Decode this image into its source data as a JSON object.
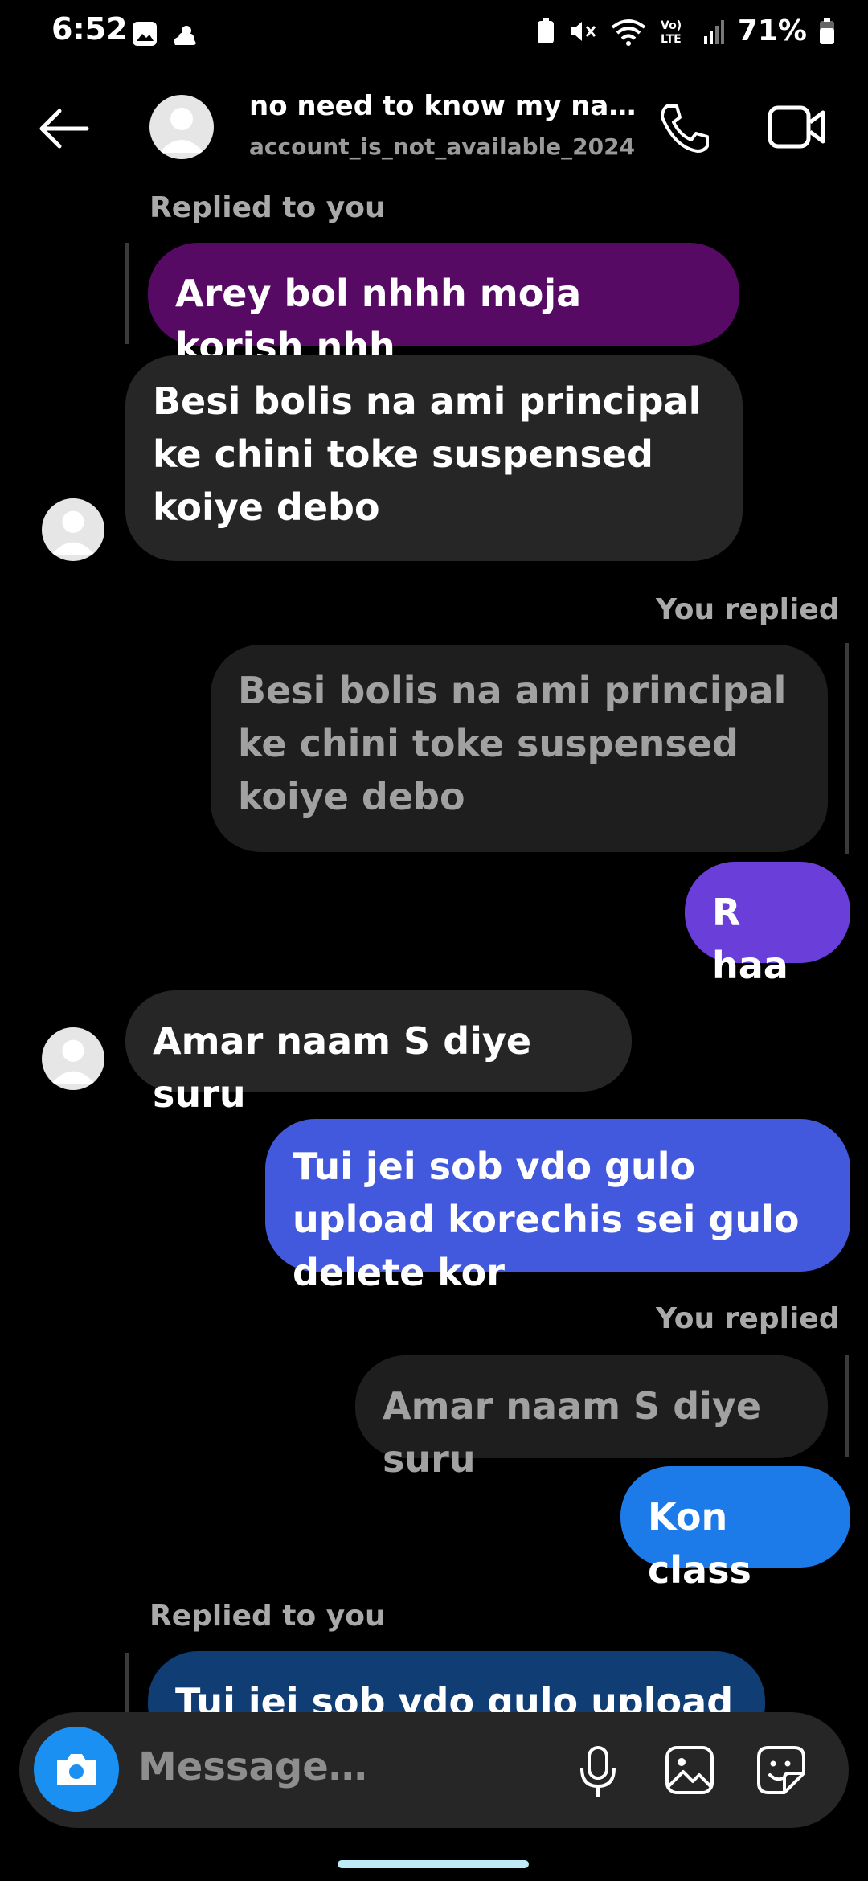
{
  "status_bar": {
    "time": "6:52",
    "battery": "71%"
  },
  "header": {
    "name": "no need to know my na…",
    "username": "account_is_not_available_2024"
  },
  "messages": [
    {
      "label": "Replied to you",
      "quoted": "Arey bol nhhh moja korish nhh",
      "text": "Besi bolis na ami principal ke chini toke suspensed koiye debo"
    },
    {
      "label": "You replied",
      "quoted": "Besi bolis na ami principal ke chini toke suspensed koiye debo",
      "text": "R haa"
    },
    {
      "text": "Amar naam S diye suru"
    },
    {
      "text": "Tui jei sob vdo gulo upload korechis sei gulo delete kor"
    },
    {
      "label": "You replied",
      "quoted": "Amar naam S diye suru",
      "text": "Kon class"
    },
    {
      "label": "Replied to you",
      "quoted": "Tui jei sob vdo gulo upload"
    }
  ],
  "composer": {
    "placeholder": "Message…"
  },
  "colors": {
    "background": "#000000",
    "incoming_bubble": "#262626",
    "quoted_purple": "#560a63",
    "outgoing_violet": "#6a3ed8",
    "outgoing_indigo": "#4258dd",
    "outgoing_blue": "#1c7be9",
    "quoted_navy": "#0f3d74",
    "camera_button": "#1990f2"
  },
  "icons": [
    "back-arrow-icon",
    "phone-icon",
    "video-icon",
    "camera-icon",
    "mic-icon",
    "gallery-icon",
    "sticker-icon",
    "wifi-icon",
    "signal-icon",
    "battery-icon",
    "mute-icon",
    "image-icon",
    "weather-icon"
  ]
}
